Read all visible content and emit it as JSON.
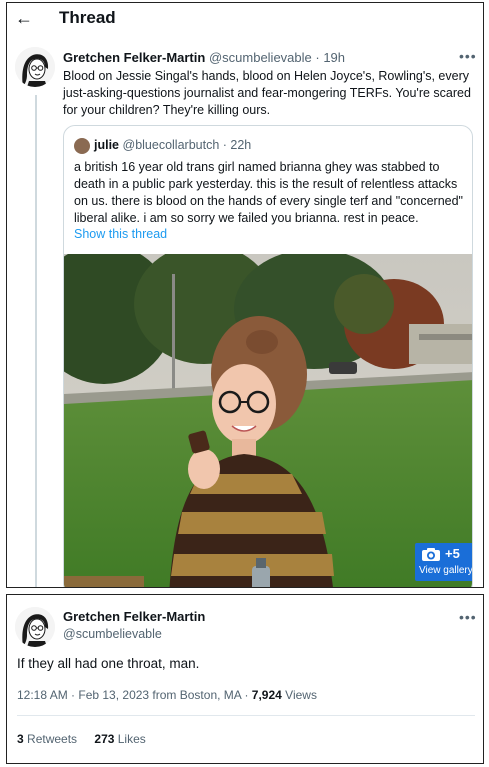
{
  "header": {
    "title": "Thread"
  },
  "main_tweet": {
    "name": "Gretchen Felker-Martin",
    "handle": "@scumbelievable",
    "time": "· 19h",
    "text": "Blood on Jessie Singal's hands, blood on Helen Joyce's, Rowling's, every just-asking-questions journalist and fear-mongering TERFs. You're scared for your children? They're killing ours."
  },
  "quoted_tweet": {
    "name": "julie",
    "handle": "@bluecollarbutch",
    "time": "· 22h",
    "text": "a british 16 year old trans girl named brianna ghey was stabbed to death in a public park yesterday. this is the result of relentless attacks on us. there is blood on the hands of every single terf and \"concerned\" liberal alike. i am so sorry we failed you brianna. rest in peace.",
    "show_thread": "Show this thread",
    "gallery": {
      "count": "+5",
      "label": "View gallery"
    }
  },
  "reply_tweet": {
    "name": "Gretchen Felker-Martin",
    "handle": "@scumbelievable",
    "text": "If they all had one throat, man.",
    "meta": "12:18 AM · Feb 13, 2023 from Boston, MA · ",
    "views_count": "7,924",
    "views_label": " Views",
    "retweets_count": "3",
    "retweets_label": " Retweets",
    "likes_count": "273",
    "likes_label": " Likes"
  },
  "colors": {
    "link": "#1d9bf0",
    "secondary_text": "#536471",
    "gallery_badge": "#1a6ed8"
  },
  "icons": [
    "back-arrow-icon",
    "more-icon",
    "camera-icon"
  ]
}
